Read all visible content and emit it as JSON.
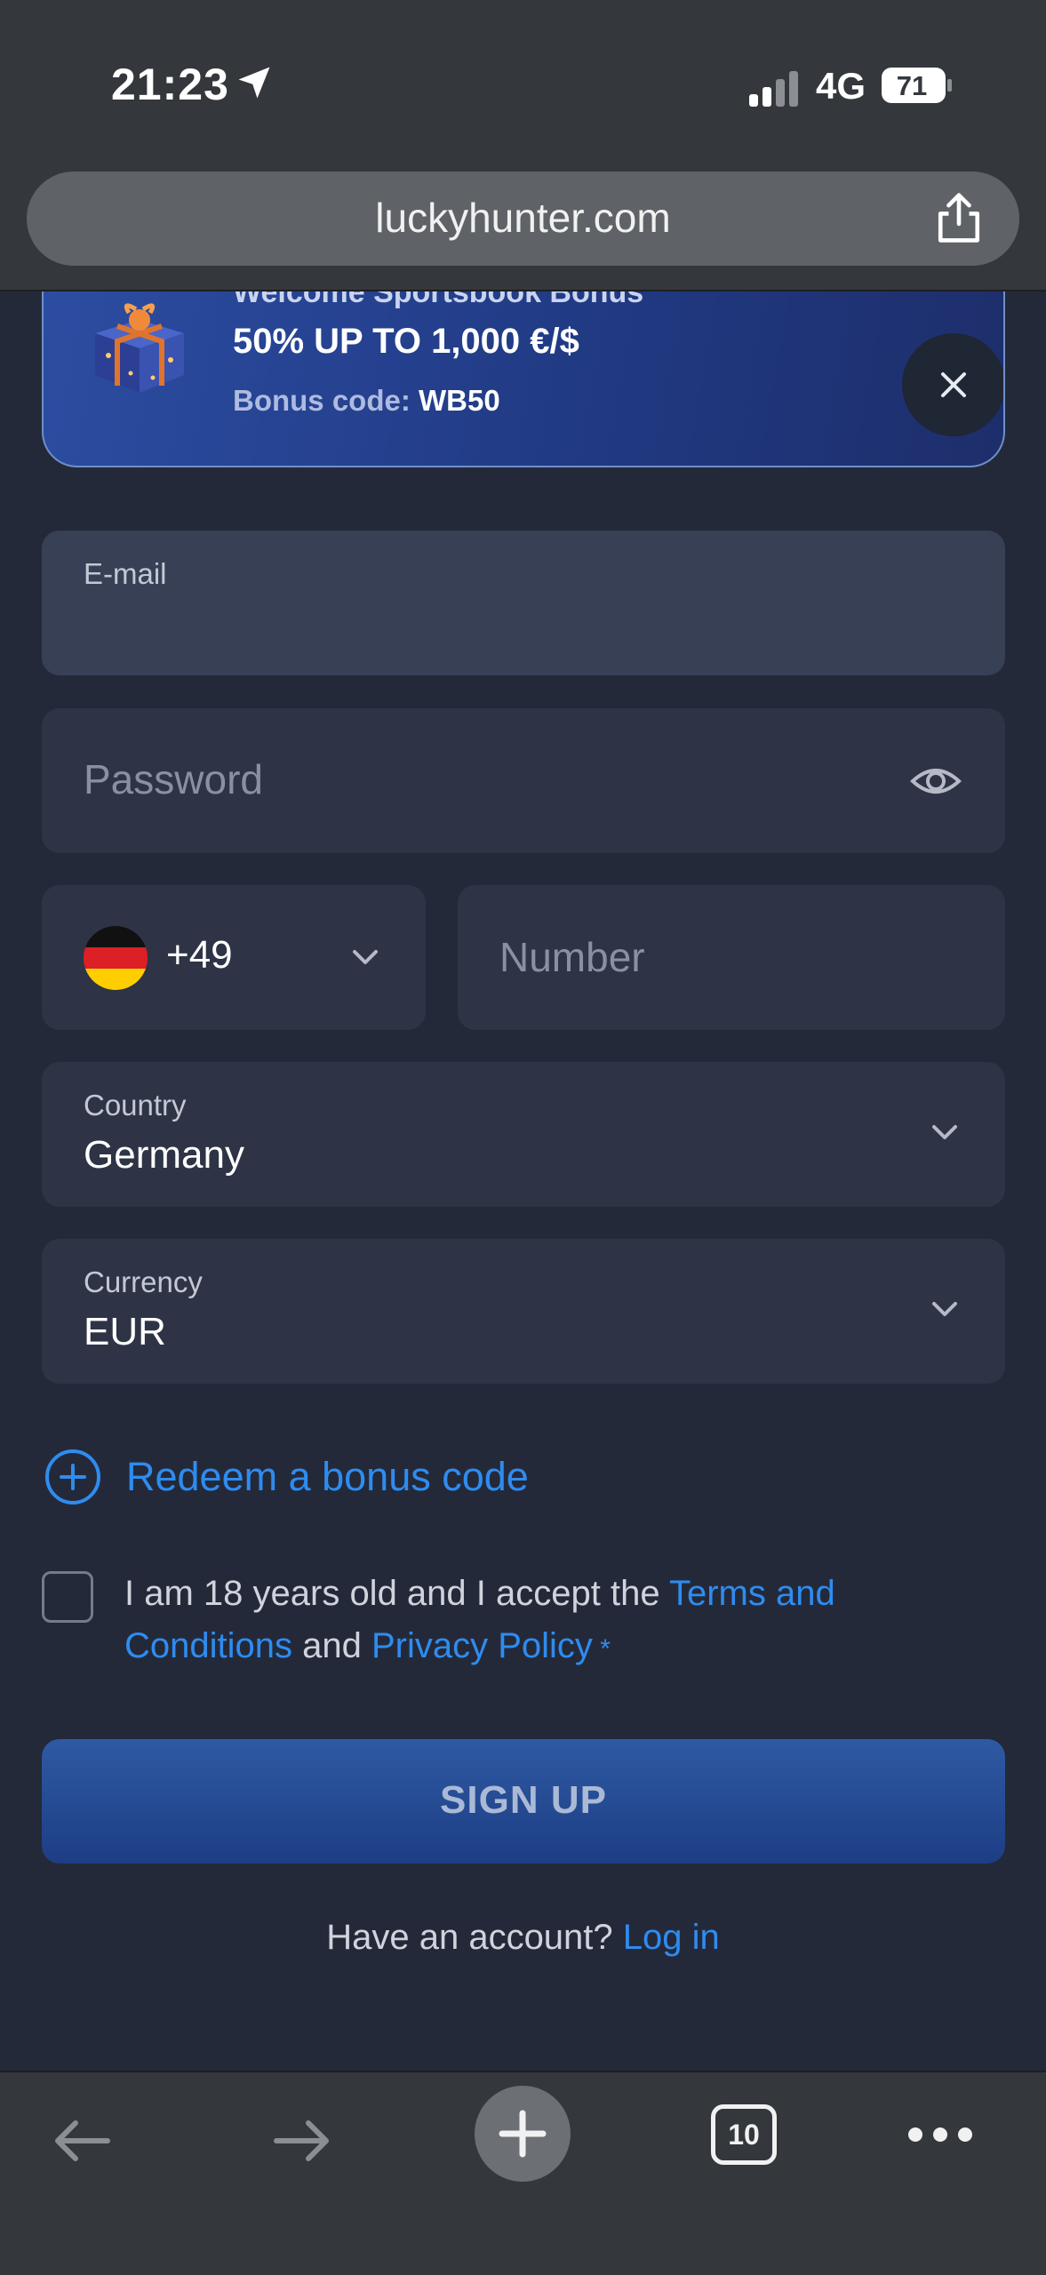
{
  "status_bar": {
    "time": "21:23",
    "network": "4G",
    "battery": "71"
  },
  "browser": {
    "url": "luckyhunter.com",
    "tab_count": "10"
  },
  "banner": {
    "cut_title": "Welcome Sportsbook Bonus",
    "title": "50% UP TO 1,000 €/$",
    "code_label": "Bonus code:",
    "code": "WB50"
  },
  "form": {
    "email_label": "E-mail",
    "password_placeholder": "Password",
    "phone_code": "+49",
    "number_placeholder": "Number",
    "country_label": "Country",
    "country_value": "Germany",
    "currency_label": "Currency",
    "currency_value": "EUR"
  },
  "redeem_label": "Redeem a bonus code",
  "terms": {
    "prefix": "I am 18 years old and I accept the ",
    "terms_link": "Terms and Conditions",
    "and": " and ",
    "privacy_link": "Privacy Policy",
    "required_mark": " *"
  },
  "signup_label": "SIGN UP",
  "login": {
    "prompt": "Have an account? ",
    "link": "Log in"
  },
  "colors": {
    "background": "#242939",
    "accent": "#2e8cf0",
    "field": "#2e3446",
    "button": "#1d3d84"
  }
}
